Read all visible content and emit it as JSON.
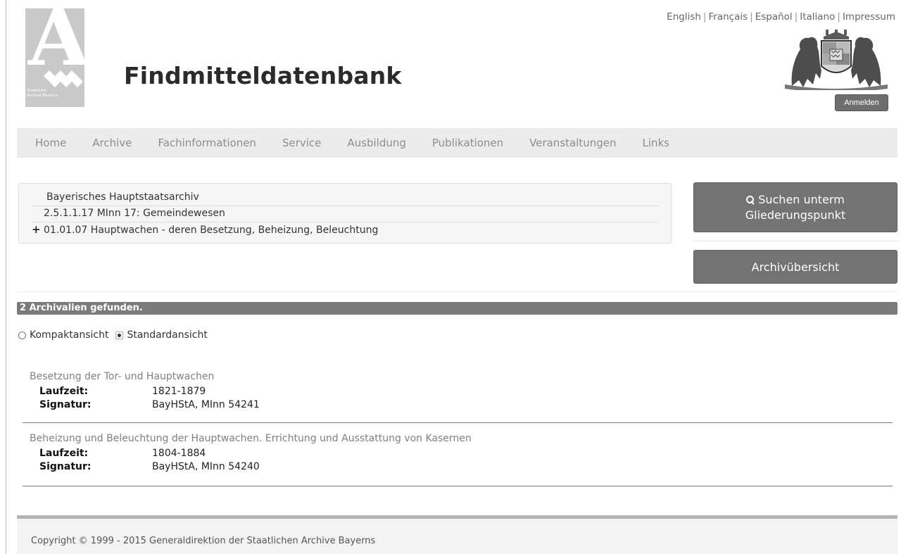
{
  "logo": {
    "line1": "Staatliche",
    "line2": "Archive Bayerns"
  },
  "site_title": "Findmitteldatenbank",
  "languages": [
    "English",
    "Français",
    "Español",
    "Italiano",
    "Impressum"
  ],
  "login_label": "Anmelden",
  "nav": [
    "Home",
    "Archive",
    "Fachinformationen",
    "Service",
    "Ausbildung",
    "Publikationen",
    "Veranstaltungen",
    "Links"
  ],
  "breadcrumb": {
    "archive": "Bayerisches Hauptstaatsarchiv",
    "section": "2.5.1.1.17 MInn 17: Gemeindewesen",
    "current": "01.01.07 Hauptwachen - deren Besetzung, Beheizung, Beleuchtung"
  },
  "buttons": {
    "search_line1": "Suchen unterm",
    "search_line2": "Gliederungspunkt",
    "overview": "Archivübersicht"
  },
  "results_text": "2 Archivalien gefunden.",
  "view_options": {
    "compact": "Kompaktansicht",
    "standard": "Standardansicht",
    "selected": "Standardansicht"
  },
  "labels": {
    "runtime": "Laufzeit:",
    "signature": "Signatur:"
  },
  "records": [
    {
      "title": "Besetzung der Tor- und Hauptwachen",
      "runtime": "1821-1879",
      "signature": "BayHStA, MInn 54241"
    },
    {
      "title": "Beheizung und Beleuchtung der Hauptwachen. Errichtung und Ausstattung von Kasernen",
      "runtime": "1804-1884",
      "signature": "BayHStA, MInn 54240"
    }
  ],
  "copyright": "Copyright © 1999 - 2015 Generaldirektion der Staatlichen Archive Bayerns"
}
